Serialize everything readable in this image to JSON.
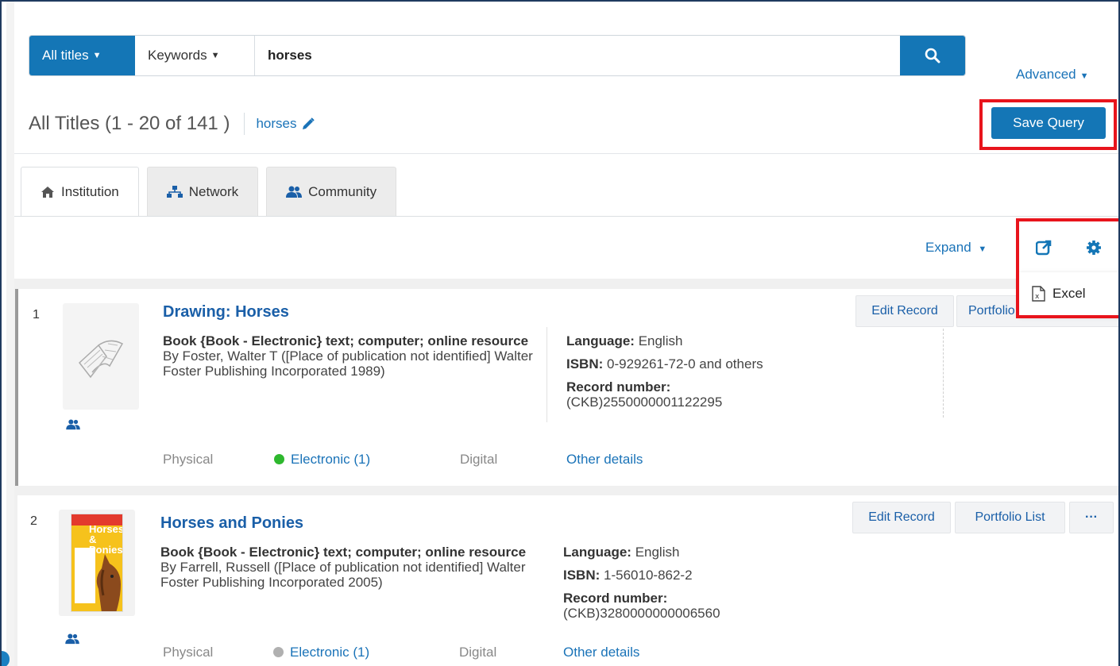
{
  "search": {
    "scope_label": "All titles",
    "field_label": "Keywords",
    "query": "horses",
    "advanced_label": "Advanced"
  },
  "results": {
    "title": "All Titles (1 - 20 of 141 )",
    "query_chip": "horses",
    "save_query_label": "Save Query"
  },
  "tabs": [
    {
      "label": "Institution",
      "icon": "home-icon",
      "active": true
    },
    {
      "label": "Network",
      "icon": "network-icon",
      "active": false
    },
    {
      "label": "Community",
      "icon": "users-icon",
      "active": false
    }
  ],
  "toolbar": {
    "expand_label": "Expand",
    "export_menu": {
      "excel_label": "Excel"
    }
  },
  "records": [
    {
      "index": "1",
      "title": "Drawing: Horses",
      "type_bold": "Book {Book - Electronic} text; computer; online resource",
      "byline": " By Foster, Walter T ([Place of publication not identified] Walter Foster Publishing Incorporated 1989)",
      "language_label": "Language:",
      "language": "English",
      "isbn_label": "ISBN:",
      "isbn": "0-929261-72-0 and others",
      "record_label": "Record number:",
      "record_number": "(CKB)2550000001122295",
      "physical": "Physical",
      "electronic": "Electronic (1)",
      "digital": "Digital",
      "other_details": "Other details",
      "edit_label": "Edit Record",
      "portfolio_label": "Portfolio List"
    },
    {
      "index": "2",
      "title": "Horses and Ponies",
      "type_bold": "Book {Book - Electronic} text; computer; online resource",
      "byline": " By Farrell, Russell ([Place of publication not identified] Walter Foster Publishing Incorporated 2005)",
      "language_label": "Language:",
      "language": "English",
      "isbn_label": "ISBN:",
      "isbn": "1-56010-862-2",
      "record_label": "Record number:",
      "record_number": "(CKB)3280000000006560",
      "physical": "Physical",
      "electronic": "Electronic (1)",
      "digital": "Digital",
      "other_details": "Other details",
      "edit_label": "Edit Record",
      "portfolio_label": "Portfolio List",
      "more_label": "···",
      "cover_text": "Horses & Ponies"
    }
  ],
  "colors": {
    "primary": "#1476b6",
    "link": "#1a73b8",
    "highlight": "#e8141c",
    "available": "#2eb82e",
    "unavailable": "#b0b0b0"
  }
}
